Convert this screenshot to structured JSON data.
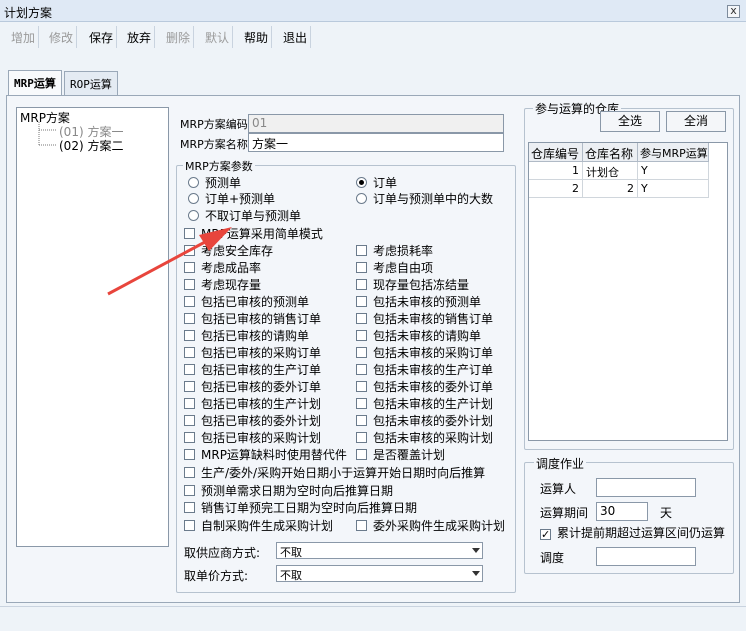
{
  "window": {
    "title": "计划方案",
    "close_label": "x"
  },
  "toolbar": {
    "buttons": [
      {
        "label": "增加",
        "enabled": false
      },
      {
        "label": "修改",
        "enabled": false
      },
      {
        "label": "保存",
        "enabled": true
      },
      {
        "label": "放弃",
        "enabled": true
      },
      {
        "label": "删除",
        "enabled": false
      },
      {
        "label": "默认",
        "enabled": false
      },
      {
        "label": "帮助",
        "enabled": true
      },
      {
        "label": "退出",
        "enabled": true
      }
    ]
  },
  "tabs": [
    {
      "label": "MRP运算",
      "active": true
    },
    {
      "label": "ROP运算",
      "active": false
    }
  ],
  "tree": {
    "root": "MRP方案",
    "items": [
      {
        "label": "(01) 方案一",
        "selected": true
      },
      {
        "label": "(02) 方案二",
        "selected": false
      }
    ]
  },
  "scheme": {
    "code_label": "MRP方案编码",
    "code_value": "01",
    "name_label": "MRP方案名称",
    "name_value": "方案一"
  },
  "params": {
    "group_title": "MRP方案参数",
    "radios": [
      {
        "label": "预测单",
        "checked": false
      },
      {
        "label": "订单",
        "checked": true
      },
      {
        "label": "订单+预测单",
        "checked": false
      },
      {
        "label": "订单与预测单中的大数",
        "checked": false
      },
      {
        "label": "不取订单与预测单",
        "checked": false
      }
    ],
    "simple_mode": {
      "label": "MRP运算采用简单模式",
      "checked": false
    },
    "checks_left": [
      "考虑安全库存",
      "考虑成品率",
      "考虑现存量",
      "包括已审核的预测单",
      "包括已审核的销售订单",
      "包括已审核的请购单",
      "包括已审核的采购订单",
      "包括已审核的生产订单",
      "包括已审核的委外订单",
      "包括已审核的生产计划",
      "包括已审核的委外计划",
      "包括已审核的采购计划",
      "MRP运算缺料时使用替代件"
    ],
    "checks_right": [
      "考虑损耗率",
      "考虑自由项",
      "现存量包括冻结量",
      "包括未审核的预测单",
      "包括未审核的销售订单",
      "包括未审核的请购单",
      "包括未审核的采购订单",
      "包括未审核的生产订单",
      "包括未审核的委外订单",
      "包括未审核的生产计划",
      "包括未审核的委外计划",
      "包括未审核的采购计划",
      "是否覆盖计划"
    ],
    "checks_full": [
      "生产/委外/采购开始日期小于运算开始日期时向后推算",
      "预测单需求日期为空时向后推算日期",
      "销售订单预完工日期为空时向后推算日期"
    ],
    "check_self_made": "自制采购件生成采购计划",
    "check_outsourced": "委外采购件生成采购计划",
    "supplier_label": "取供应商方式:",
    "supplier_value": "不取",
    "price_label": "取单价方式:",
    "price_value": "不取"
  },
  "warehouse": {
    "group_title": "参与运算的仓库",
    "select_all": "全选",
    "deselect_all": "全消",
    "columns": [
      "仓库编号",
      "仓库名称",
      "参与MRP运算"
    ],
    "rows": [
      [
        "1",
        "计划仓",
        "Y"
      ],
      [
        "2",
        "2",
        "Y"
      ]
    ]
  },
  "dispatch": {
    "group_title": "调度作业",
    "operator_label": "运算人",
    "operator_value": "",
    "period_label": "运算期间",
    "period_value": "30",
    "period_unit": "天",
    "overdue_label": "累计提前期超过运算区间仍运算",
    "overdue_checked": true,
    "schedule_label": "调度",
    "schedule_value": ""
  },
  "colors": {
    "annotation_arrow": "#e8453c"
  }
}
